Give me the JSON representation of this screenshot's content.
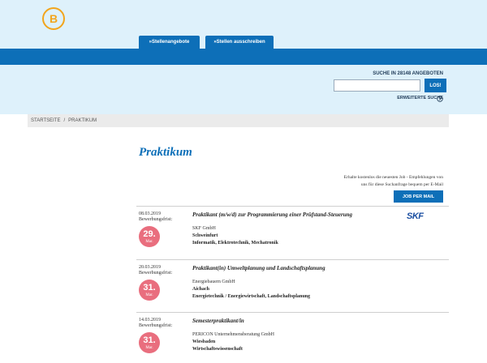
{
  "header": {
    "logo_letter": "B",
    "tabs": [
      {
        "label": "»Stellenangebote"
      },
      {
        "label": "»Stellen ausschreiben"
      }
    ]
  },
  "search": {
    "label": "SUCHE IN 28148 ANGEBOTEN",
    "value": "",
    "button_label": "LOS!",
    "advanced_label": "ERWEITERTE SUCHE"
  },
  "breadcrumb": {
    "home": "STARTSEITE",
    "separator": "/",
    "current": "PRAKTIKUM"
  },
  "page_title": "Praktikum",
  "promo": {
    "text_line1": "Erhalte kostenlos die neuesten Job - Empfehlungen von",
    "text_line2": "uns für diese Suchanfrage bequem per E-Mail",
    "button_label": "JOB PER MAIL"
  },
  "jobs": [
    {
      "date": "08.03.2019",
      "deadline_label": "Bewerbungsfrist:",
      "deadline_day": "29.",
      "deadline_month": "Mar.",
      "title": "Praktikant (m/w/d) zur Programmierung einer Prüfstand-Steuerung",
      "company": "SKF GmbH",
      "city": "Schweinfurt",
      "field": "Informatik, Elektrotechnik, Mechatronik",
      "company_logo": "SKF"
    },
    {
      "date": "20.03.2019",
      "deadline_label": "Bewerbungsfrist:",
      "deadline_day": "31.",
      "deadline_month": "Mar.",
      "title": "Praktikant(in) Umweltplanung und Landschaftsplanung",
      "company": "Energiebauern GmbH",
      "city": "Aichach",
      "field": "Energietechnik / Energiewirtschaft, Landschaftsplanung",
      "company_logo": ""
    },
    {
      "date": "14.03.2019",
      "deadline_label": "Bewerbungsfrist:",
      "deadline_day": "31.",
      "deadline_month": "Mar.",
      "title": "Semesterpraktikant/in",
      "company": "PERICON Unternehmensberatung GmbH",
      "city": "Wiesbaden",
      "field": "Wirtschaftswissenschaft",
      "company_logo": ""
    }
  ],
  "colors": {
    "brand_blue": "#0d6fb8",
    "header_bg": "#def1fb",
    "deadline_badge": "#e96e7e",
    "logo_orange": "#f2a51c"
  }
}
